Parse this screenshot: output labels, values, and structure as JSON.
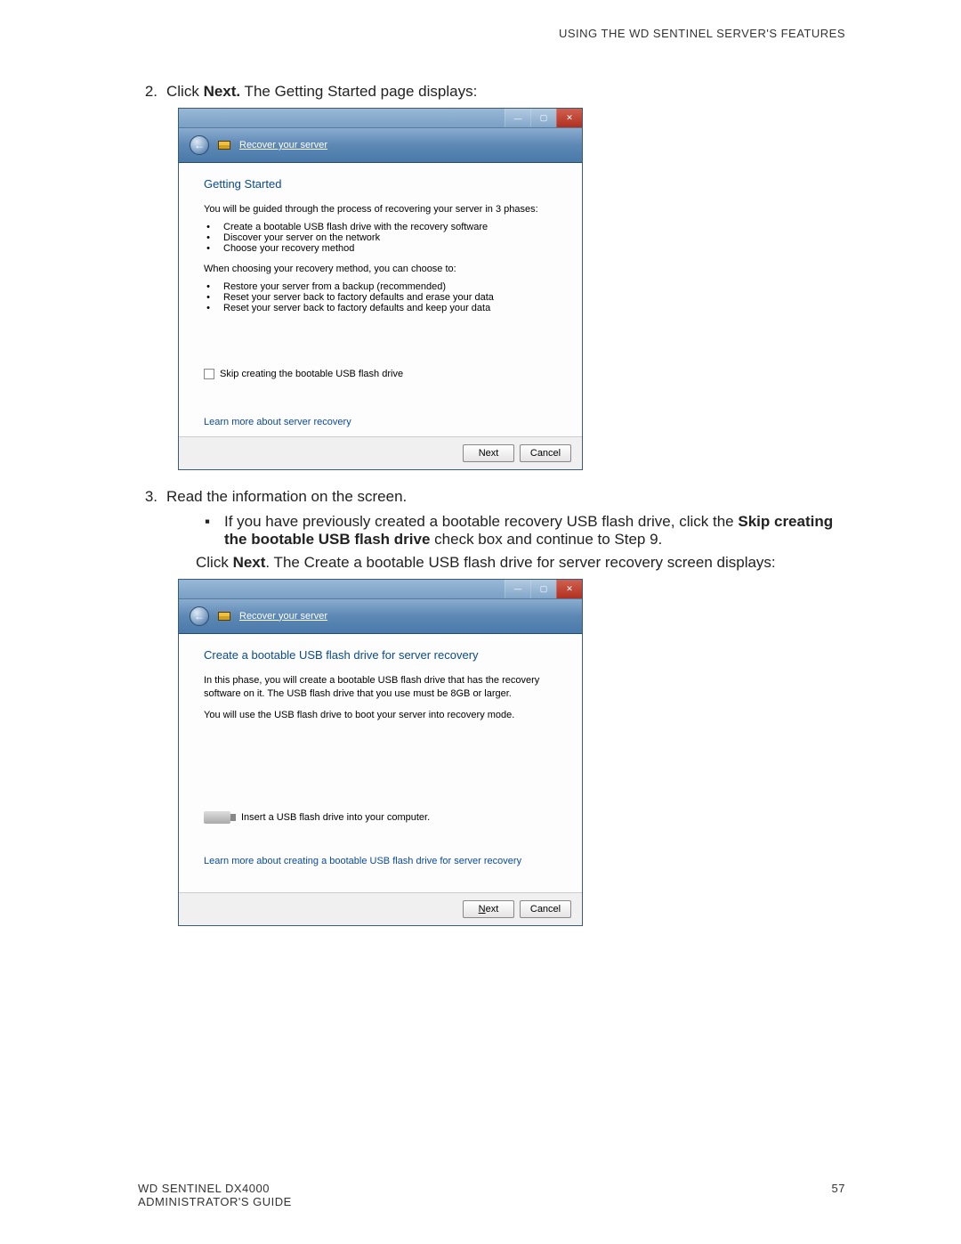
{
  "header": "USING THE WD SENTINEL SERVER'S FEATURES",
  "step2": {
    "num": "2.",
    "pre": "Click ",
    "bold": "Next.",
    "post": " The Getting Started page displays:"
  },
  "wizard1": {
    "back_nav_title": "Recover your server",
    "heading": "Getting Started",
    "intro": "You will be guided through the process  of recovering your server in 3 phases:",
    "phase_items": [
      "Create a bootable USB flash drive with the recovery software",
      "Discover your server on the network",
      "Choose your recovery method"
    ],
    "choose_intro": "When choosing your recovery method, you can choose to:",
    "choose_items": [
      "Restore your server from a backup (recommended)",
      "Reset your server back to factory defaults and erase your data",
      "Reset your server back to factory defaults and keep your data"
    ],
    "skip_label": "Skip creating the bootable USB flash drive",
    "learn_link": "Learn more about server recovery",
    "next": "Next",
    "cancel": "Cancel"
  },
  "step3": {
    "num": "3.",
    "text": "Read the information on the screen.",
    "bullet_pre": "If you have previously created a bootable recovery USB flash drive, click the ",
    "bullet_bold1": "Skip creating the bootable USB flash drive",
    "bullet_post": " check box and continue to Step 9.",
    "line2_pre": "Click ",
    "line2_bold": "Next",
    "line2_post": ". The Create a bootable USB flash drive for server recovery screen displays:"
  },
  "wizard2": {
    "back_nav_title": "Recover your server",
    "heading": "Create a bootable USB flash drive for server recovery",
    "p1": "In this phase, you will create a bootable USB flash drive that has the recovery software on it. The USB flash drive that you use must be 8GB or larger.",
    "p2": "You will use the USB flash drive to boot your server into recovery mode.",
    "insert": "Insert a USB flash drive into your computer.",
    "learn_link": "Learn more about creating a bootable USB flash drive for server recovery",
    "next": "Next",
    "cancel": "Cancel"
  },
  "footer": {
    "left1": "WD SENTINEL DX4000",
    "left2": "ADMINISTRATOR'S GUIDE",
    "page": "57"
  }
}
